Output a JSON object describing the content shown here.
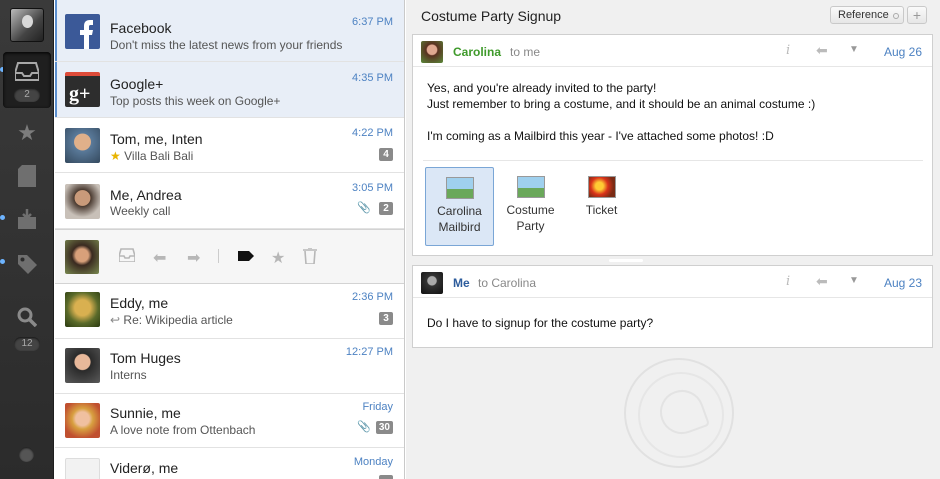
{
  "sidebar": {
    "inbox_count": "2",
    "search_count": "12"
  },
  "messages_top": [
    {
      "sender": "Facebook",
      "subject": "Don't miss the latest news from your friends",
      "time": "6:37 PM"
    },
    {
      "sender": "Google+",
      "subject": "Top posts this week on Google+",
      "time": "4:35 PM"
    },
    {
      "sender": "Tom, me, Inten",
      "subject": "Villa Bali Bali",
      "time": "4:22 PM",
      "count": "4"
    },
    {
      "sender": "Me, Andrea",
      "subject": "Weekly call",
      "time": "3:05 PM",
      "count": "2"
    }
  ],
  "messages_bottom": [
    {
      "sender": "Eddy, me",
      "subject": "Re: Wikipedia article",
      "time": "2:36 PM",
      "count": "3"
    },
    {
      "sender": "Tom Huges",
      "subject": "Interns",
      "time": "12:27 PM"
    },
    {
      "sender": "Sunnie, me",
      "subject": "A love note from Ottenbach",
      "time": "Friday",
      "count": "30"
    },
    {
      "sender": "Viderø, me",
      "subject": "",
      "time": "Monday"
    }
  ],
  "pane": {
    "title": "Costume Party Signup",
    "tag": "Reference",
    "add": "+"
  },
  "email1": {
    "from": "Carolina",
    "to": "to me",
    "date": "Aug 26",
    "lines": [
      "Yes, and you're already invited to the party!",
      "Just remember to bring a costume, and it should be an animal costume :)",
      "I'm coming as a Mailbird this year - I've attached some photos! :D"
    ],
    "attachments": [
      {
        "line1": "Carolina",
        "line2": "Mailbird"
      },
      {
        "line1": "Costume",
        "line2": "Party"
      },
      {
        "line1": "Ticket",
        "line2": ""
      }
    ]
  },
  "email2": {
    "from": "Me",
    "to": "to Carolina",
    "date": "Aug 23",
    "line": "Do I have to signup for the costume party?"
  },
  "colors": {
    "accent": "#4d82c2",
    "sender_green": "#3f9a2b",
    "me_blue": "#2d5c9c",
    "sidebar": "#2b2b2b"
  }
}
